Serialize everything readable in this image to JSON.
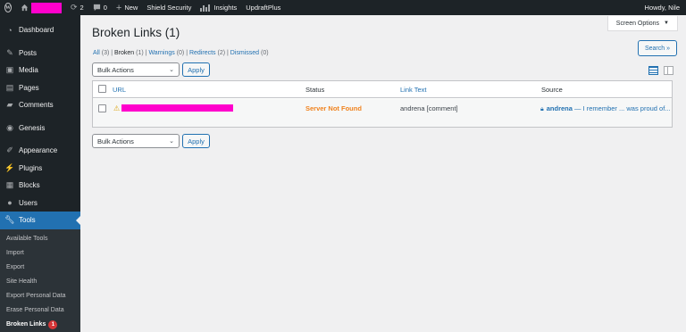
{
  "adminbar": {
    "updates_count": "2",
    "comments_count": "0",
    "new_label": "New",
    "shield_label": "Shield Security",
    "insights_label": "Insights",
    "updraft_label": "UpdraftPlus",
    "howdy": "Howdy, Nile"
  },
  "sidebar": {
    "items": [
      {
        "label": "Dashboard",
        "icon": "dashboard-icon"
      },
      {
        "label": "Posts",
        "icon": "pin-icon"
      },
      {
        "label": "Media",
        "icon": "media-icon"
      },
      {
        "label": "Pages",
        "icon": "pages-icon"
      },
      {
        "label": "Comments",
        "icon": "comment-icon"
      },
      {
        "label": "Genesis",
        "icon": "genesis-icon"
      },
      {
        "label": "Appearance",
        "icon": "brush-icon"
      },
      {
        "label": "Plugins",
        "icon": "plugin-icon"
      },
      {
        "label": "Blocks",
        "icon": "blocks-icon"
      },
      {
        "label": "Users",
        "icon": "users-icon"
      },
      {
        "label": "Tools",
        "icon": "wrench-icon"
      }
    ],
    "submenu": [
      "Available Tools",
      "Import",
      "Export",
      "Site Health",
      "Export Personal Data",
      "Erase Personal Data",
      "Broken Links"
    ],
    "broken_links_badge": "1"
  },
  "page": {
    "screen_options": "Screen Options",
    "title": "Broken Links (1)",
    "search_button": "Search »",
    "views": {
      "all": "All",
      "all_count": "(3)",
      "broken": "Broken",
      "broken_count": "(1)",
      "warnings": "Warnings",
      "warnings_count": "(0)",
      "redirects": "Redirects",
      "redirects_count": "(2)",
      "dismissed": "Dismissed",
      "dismissed_count": "(0)"
    },
    "bulk_actions": "Bulk Actions",
    "apply": "Apply"
  },
  "table": {
    "columns": {
      "url": "URL",
      "status": "Status",
      "link_text": "Link Text",
      "source": "Source"
    },
    "rows": [
      {
        "status": "Server Not Found",
        "link_text": "andrena [comment]",
        "source_author": "andrena",
        "source_rest": " — I remember ... was proud of..."
      }
    ]
  },
  "colors": {
    "accent": "#2271b1",
    "admin_dark": "#1d2327",
    "status_error": "#f0821e",
    "warning_icon": "#dba617",
    "badge": "#d63638"
  }
}
